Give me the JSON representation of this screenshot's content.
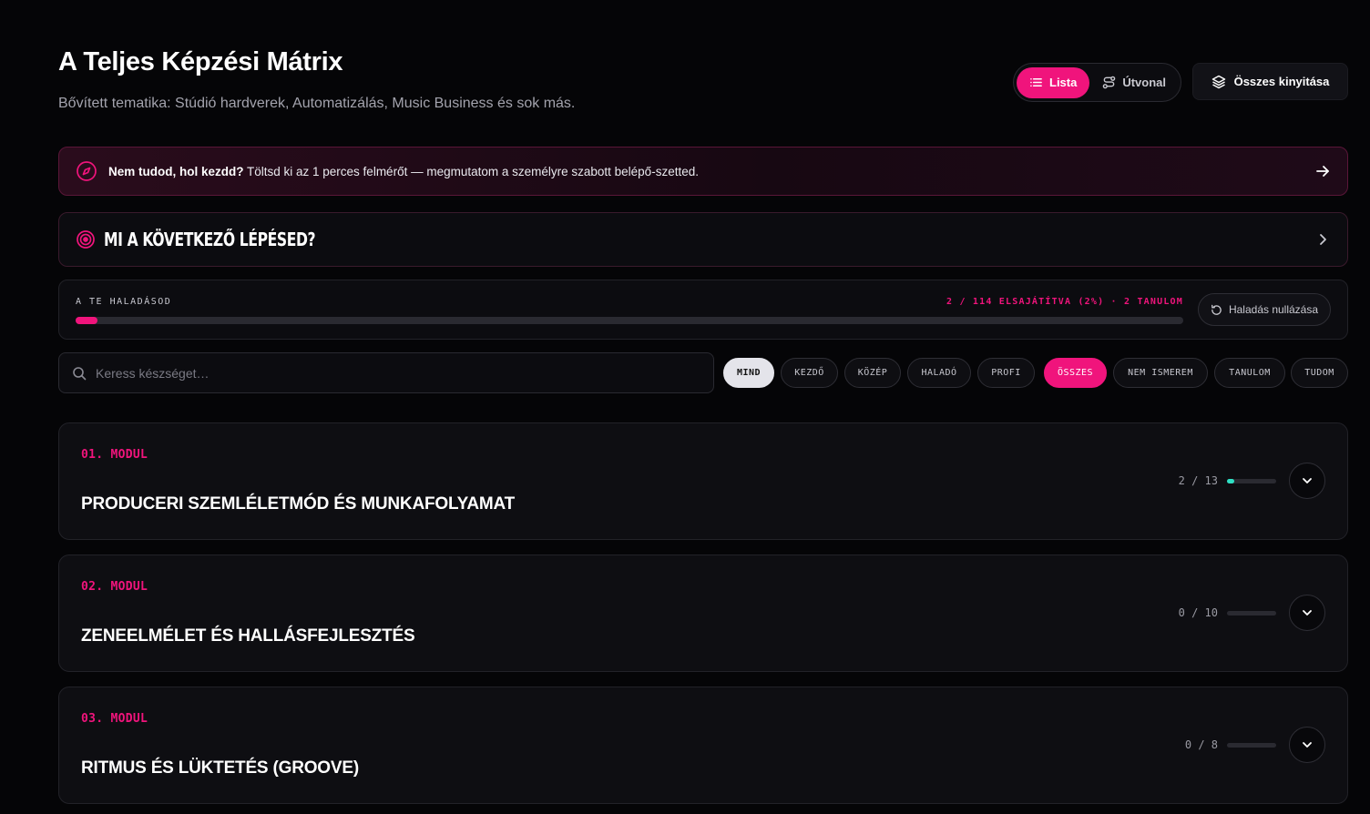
{
  "header": {
    "title": "A Teljes Képzési Mátrix",
    "subtitle": "Bővített tematika: Stúdió hardverek, Automatizálás, Music Business és sok más."
  },
  "view_toggle": {
    "list_label": "Lista",
    "path_label": "Útvonal",
    "active": "list"
  },
  "expand_all_label": "Összes kinyitása",
  "banner": {
    "bold": "Nem tudod, hol kezdd?",
    "text": " Töltsd ki az 1 perces felmérőt — megmutatom a személyre szabott belépő-szetted."
  },
  "next_step": {
    "label": "MI A KÖVETKEZŐ LÉPÉSED?"
  },
  "progress": {
    "label": "A TE HALADÁSOD",
    "stat": "2 / 114 ELSAJÁTÍTVA (2%) · 2 TANULOM",
    "percent": 2,
    "reset_label": "Haladás nullázása"
  },
  "search": {
    "placeholder": "Keress készséget…"
  },
  "filters": [
    {
      "label": "MIND",
      "style": "white"
    },
    {
      "label": "KEZDŐ",
      "style": "normal"
    },
    {
      "label": "KÖZÉP",
      "style": "normal"
    },
    {
      "label": "HALADÓ",
      "style": "normal"
    },
    {
      "label": "PROFI",
      "style": "normal"
    },
    {
      "label": "ÖSSZES",
      "style": "pink"
    },
    {
      "label": "NEM ISMEREM",
      "style": "normal"
    },
    {
      "label": "TANULOM",
      "style": "normal"
    },
    {
      "label": "TUDOM",
      "style": "normal"
    }
  ],
  "modules": [
    {
      "number": "01. MODUL",
      "name": "PRODUCERI SZEMLÉLETMÓD ÉS MUNKAFOLYAMAT",
      "done": 2,
      "total": 13,
      "count_label": "2 / 13"
    },
    {
      "number": "02. MODUL",
      "name": "ZENEELMÉLET ÉS HALLÁSFEJLESZTÉS",
      "done": 0,
      "total": 10,
      "count_label": "0 / 10"
    },
    {
      "number": "03. MODUL",
      "name": "RITMUS ÉS LÜKTETÉS (GROOVE)",
      "done": 0,
      "total": 8,
      "count_label": "0 / 8"
    }
  ],
  "colors": {
    "accent": "#f0147c",
    "teal": "#2fe0c4",
    "background": "#050507"
  }
}
